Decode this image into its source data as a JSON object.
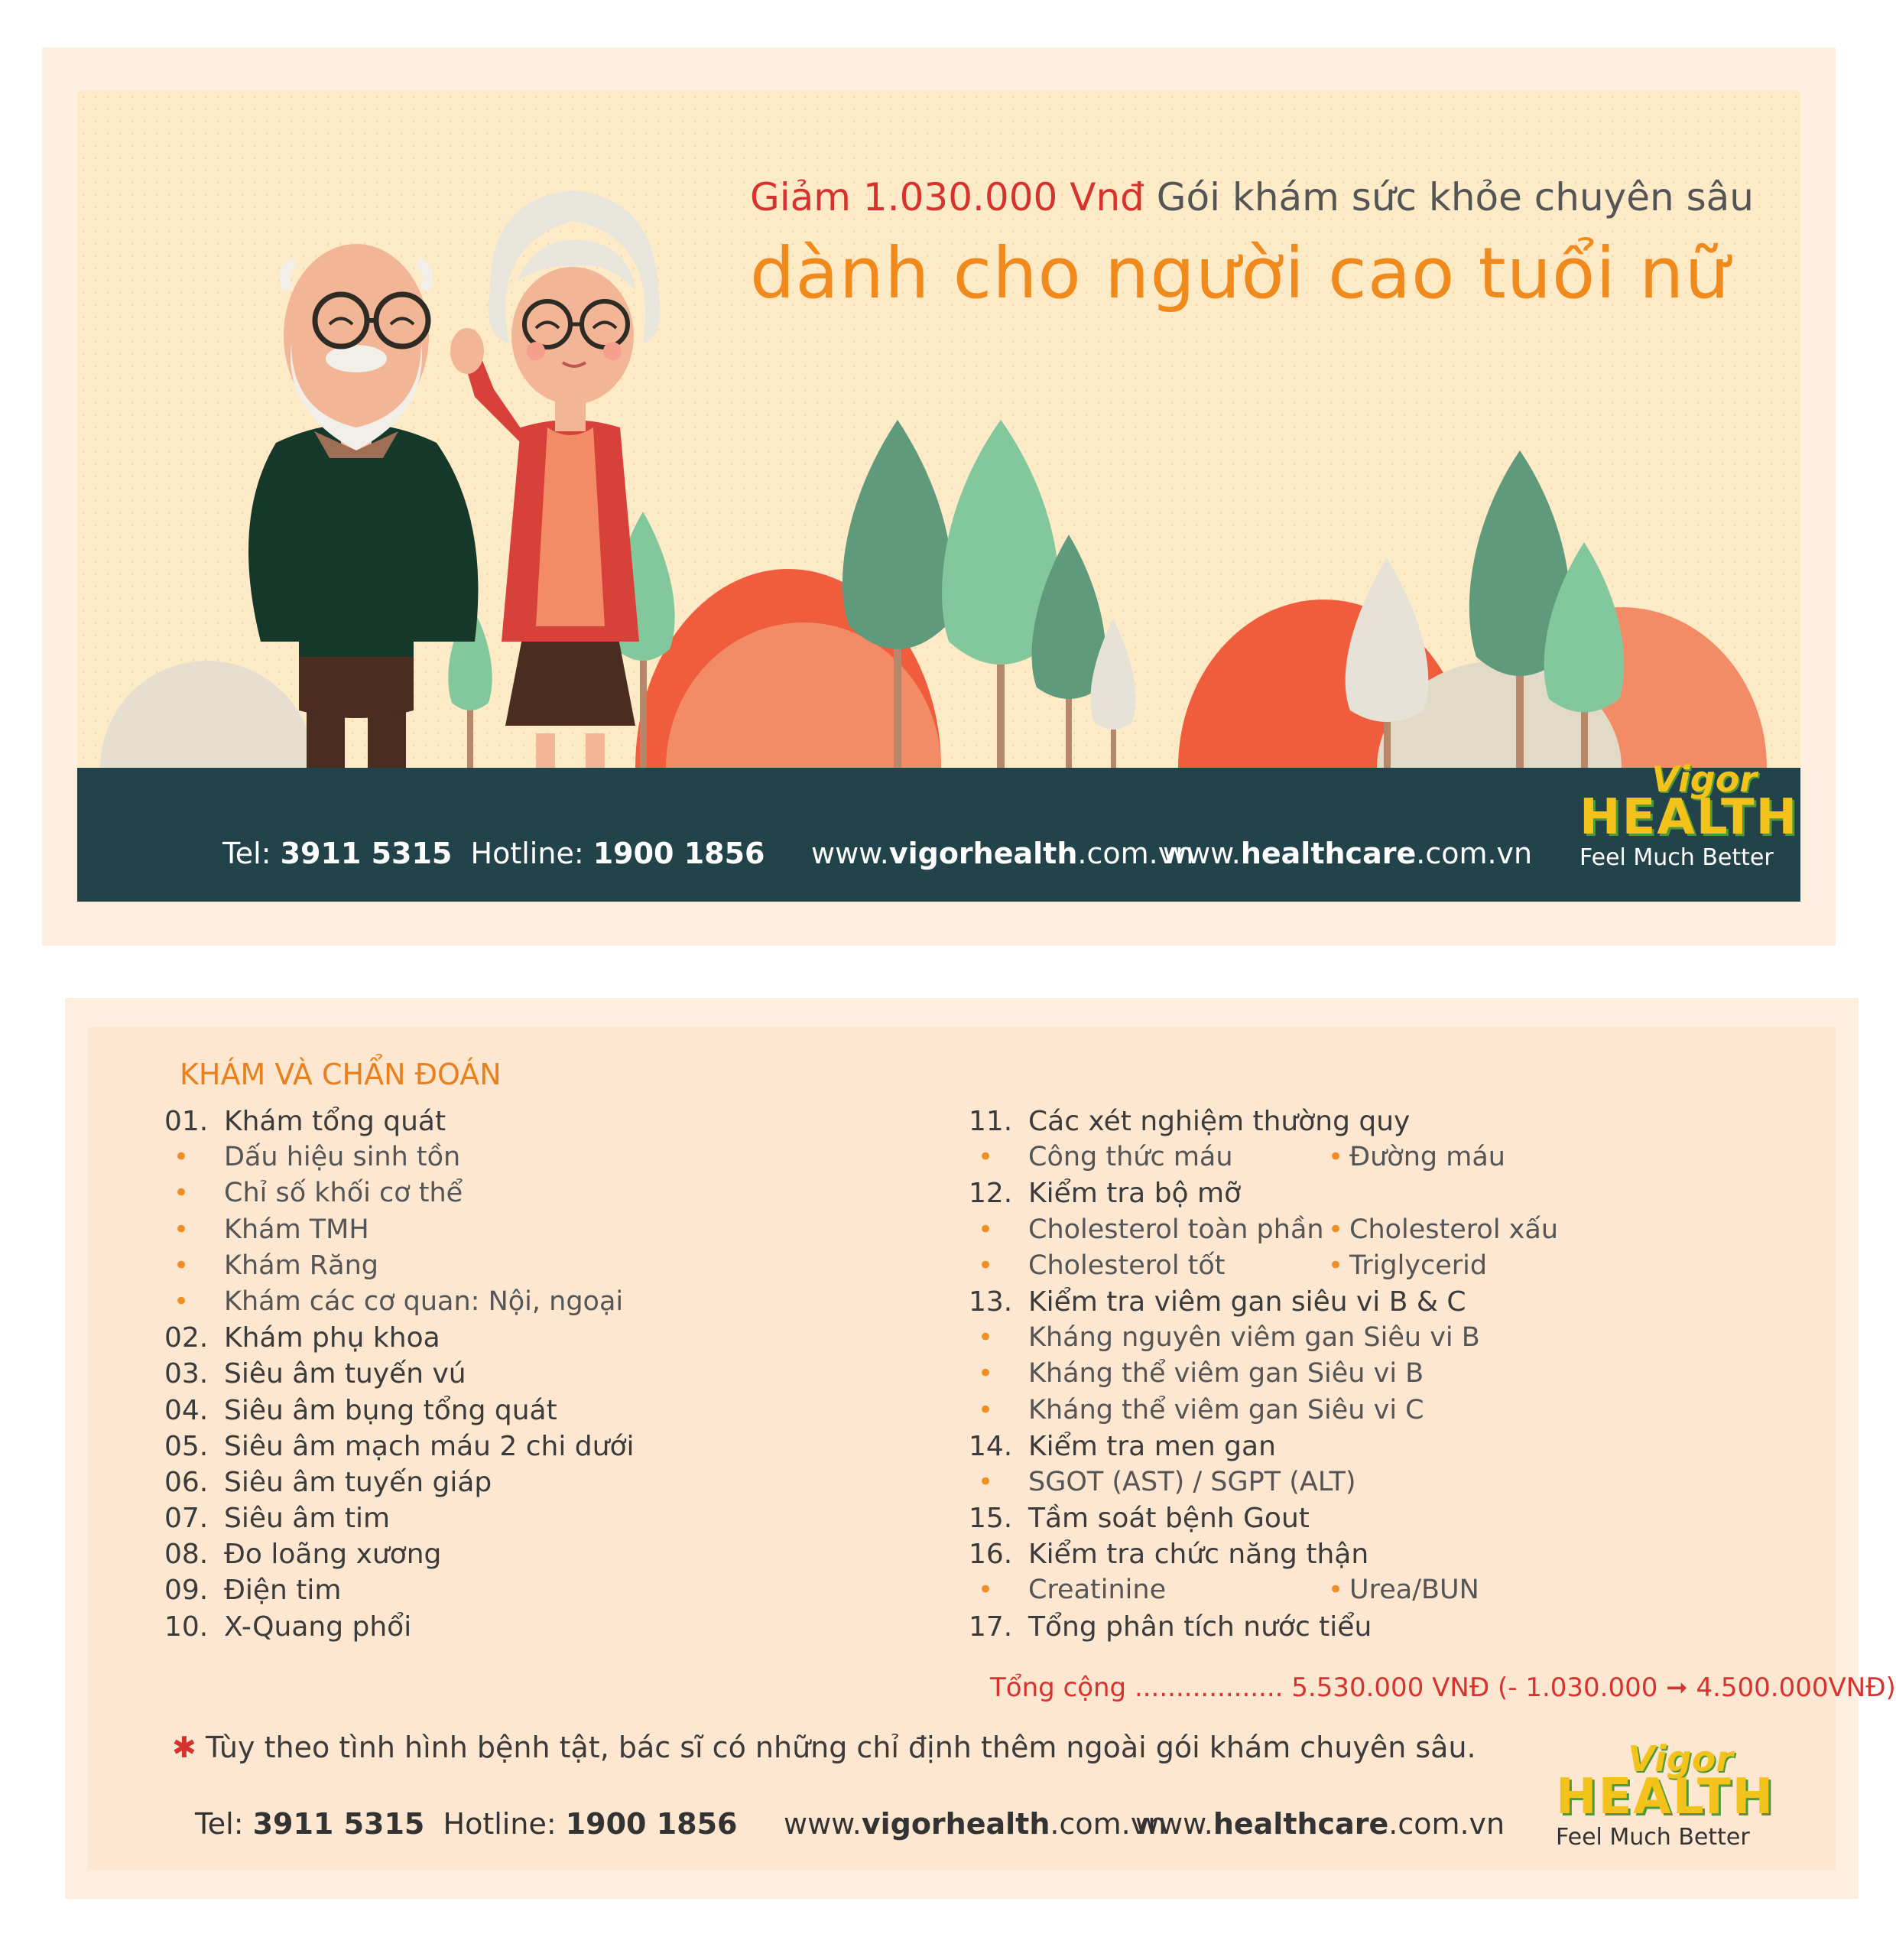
{
  "front": {
    "discount_text": "Giảm 1.030.000 Vnđ",
    "package_text": "Gói khám sức khỏe chuyên sâu",
    "audience_text": "dành cho người cao tuổi nữ",
    "tel_label": "Tel:",
    "tel_number": "3911 5315",
    "hotline_label": "Hotline:",
    "hotline_number": "1900 1856",
    "web1_prefix": "www.",
    "web1_bold": "vigorhealth",
    "web1_suffix": ".com.vn",
    "web2_prefix": "www.",
    "web2_bold": "healthcare",
    "web2_suffix": ".com.vn"
  },
  "logo": {
    "vigor": "Vigor",
    "health": "HEALTH",
    "tagline": "Feel Much Better"
  },
  "back": {
    "section_title": "KHÁM VÀ CHẨN ĐOÁN",
    "left_items": [
      {
        "num": "01.",
        "text": "Khám tổng quát"
      },
      {
        "num": "",
        "text": "Dấu hiệu sinh tồn"
      },
      {
        "num": "",
        "text": "Chỉ số khối cơ thể"
      },
      {
        "num": "",
        "text": "Khám TMH"
      },
      {
        "num": "",
        "text": "Khám Răng"
      },
      {
        "num": "",
        "text": "Khám các cơ quan: Nội, ngoại"
      },
      {
        "num": "02.",
        "text": "Khám phụ khoa"
      },
      {
        "num": "03.",
        "text": "Siêu âm tuyến vú"
      },
      {
        "num": "04.",
        "text": "Siêu âm bụng tổng quát"
      },
      {
        "num": "05.",
        "text": "Siêu âm mạch máu 2 chi dưới"
      },
      {
        "num": "06.",
        "text": "Siêu âm tuyến giáp"
      },
      {
        "num": "07.",
        "text": "Siêu âm tim"
      },
      {
        "num": "08.",
        "text": "Đo loãng xương"
      },
      {
        "num": "09.",
        "text": "Điện tim"
      },
      {
        "num": "10.",
        "text": "X-Quang phổi"
      }
    ],
    "right_items": [
      {
        "num": "11.",
        "text": "Các xét nghiệm thường quy",
        "text2": ""
      },
      {
        "num": "",
        "text": "Công thức máu",
        "text2": "Đường máu"
      },
      {
        "num": "12.",
        "text": "Kiểm tra bộ mỡ",
        "text2": ""
      },
      {
        "num": "",
        "text": "Cholesterol toàn phần",
        "text2": "Cholesterol xấu"
      },
      {
        "num": "",
        "text": "Cholesterol tốt",
        "text2": "Triglycerid"
      },
      {
        "num": "13.",
        "text": "Kiểm tra viêm gan siêu vi B & C",
        "text2": ""
      },
      {
        "num": "",
        "text": "Kháng nguyên viêm gan Siêu vi B",
        "text2": ""
      },
      {
        "num": "",
        "text": "Kháng thể viêm gan Siêu vi B",
        "text2": ""
      },
      {
        "num": "",
        "text": "Kháng thể viêm gan Siêu vi C",
        "text2": ""
      },
      {
        "num": "14.",
        "text": "Kiểm tra men gan",
        "text2": ""
      },
      {
        "num": "",
        "text": "SGOT (AST) / SGPT (ALT)",
        "text2": ""
      },
      {
        "num": "15.",
        "text": "Tầm soát bệnh Gout",
        "text2": ""
      },
      {
        "num": "16.",
        "text": "Kiểm tra chức năng thận",
        "text2": ""
      },
      {
        "num": "",
        "text": "Creatinine",
        "text2": "Urea/BUN"
      },
      {
        "num": "17.",
        "text": "Tổng phân tích nước tiểu",
        "text2": ""
      }
    ],
    "total_text": "Tổng cộng .................. 5.530.000 VNĐ (- 1.030.000 ➞ 4.500.000VNĐ)",
    "note_text": "Tùy theo tình hình bệnh tật, bác sĩ có những chỉ định thêm ngoài gói khám chuyên sâu."
  },
  "colors": {
    "red": "#d6332f",
    "orange": "#f08a1d",
    "ground": "#22434a",
    "logo_yellow": "#f3c21b",
    "logo_green": "#4c9a3a"
  }
}
